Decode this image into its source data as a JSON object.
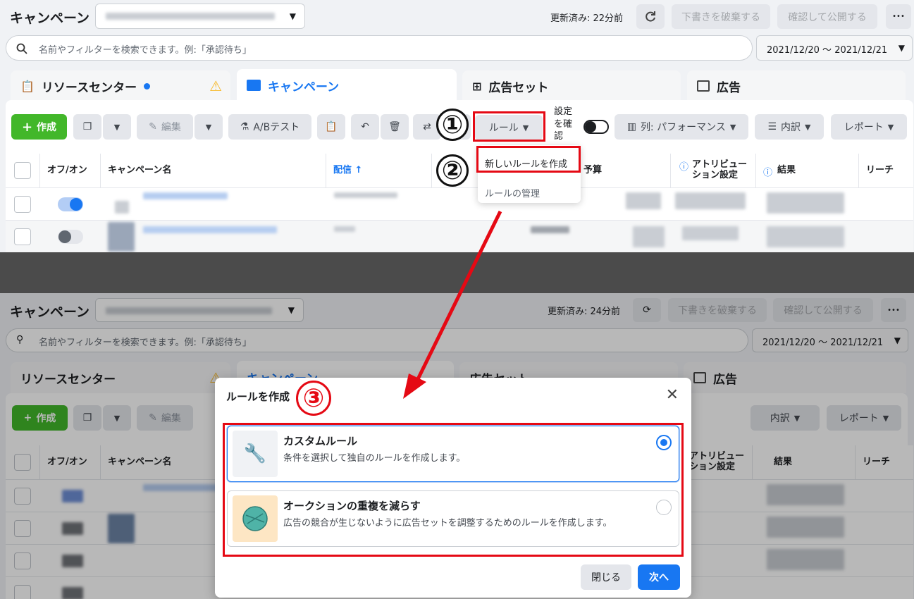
{
  "top": {
    "title": "キャンペーン",
    "updated": "更新済み: 22分前",
    "discard": "下書きを破棄する",
    "publish": "確認して公開する",
    "more": "•••",
    "search_placeholder": "名前やフィルターを検索できます。例:「承認待ち」",
    "date_range": "2021/12/20 ～ 2021/12/21"
  },
  "tabs": [
    {
      "label": "リソースセンター"
    },
    {
      "label": "キャンペーン"
    },
    {
      "label": "広告セット"
    },
    {
      "label": "広告"
    }
  ],
  "toolbar": {
    "create": "作成",
    "edit": "編集",
    "ab_test": "A/Bテスト",
    "rules": "ルール",
    "setting_check": "設定を確認",
    "columns": "列: パフォーマンス",
    "breakdown": "内訳",
    "report": "レポート"
  },
  "dropdown": {
    "create_rule": "新しいルールを作成",
    "manage_rules": "ルールの管理"
  },
  "table": {
    "headers": [
      "オフ/オン",
      "キャンペーン名",
      "配信 ↑",
      "予算",
      "アトリビューション設定",
      "結果",
      "リーチ"
    ]
  },
  "annotations": {
    "step1": "①",
    "step2": "②",
    "step3": "③"
  },
  "bottom": {
    "updated": "更新済み: 24分前"
  },
  "modal": {
    "title": "ルールを作成",
    "options": [
      {
        "title": "カスタムルール",
        "desc": "条件を選択して独自のルールを作成します。",
        "selected": true
      },
      {
        "title": "オークションの重複を減らす",
        "desc": "広告の競合が生じないように広告セットを調整するためのルールを作成します。",
        "selected": false
      }
    ],
    "close": "閉じる",
    "next": "次へ"
  },
  "colors": {
    "accent": "#1877f2",
    "green": "#42b72a",
    "annotation": "#e50914",
    "warning": "#f7b928"
  }
}
